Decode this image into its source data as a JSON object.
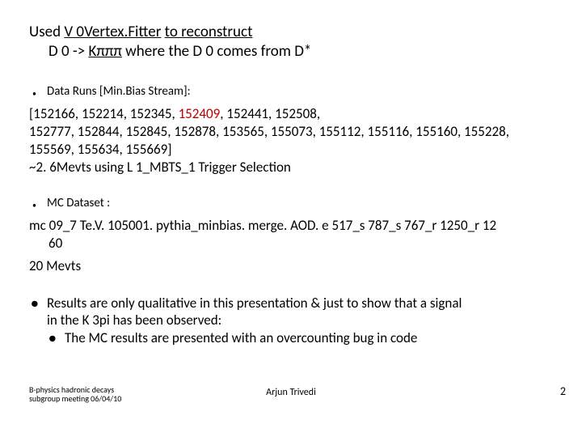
{
  "title": {
    "prefix": "Used  ",
    "underlined1": "V 0Vertex.Fitter",
    "mid1": " ",
    "underlined2": "to reconstruct",
    "line2_a": "D 0 -> ",
    "line2_underlined": "Kπππ",
    "line2_b": " where the D 0 comes from D*"
  },
  "dataRunsLabel": "Data Runs [Min.Bias Stream]:",
  "dataRuns": {
    "line1_a": "[152166, 152214, 152345, ",
    "line1_red": "152409",
    "line1_b": ", 152441, 152508,",
    "line2": "152777, 152844, 152845, 152878, 153565, 155073, 155112, 155116, 155160, 155228, 155569, 155634, 155669]",
    "line3": "~2. 6Mevts using L 1_MBTS_1 Trigger Selection"
  },
  "mcLabel": "MC Dataset :",
  "mc": {
    "line1": "mc 09_7 Te.V. 105001. pythia_minbias. merge. AOD. e 517_s 787_s 767_r 1250_r 12",
    "line1b": "60",
    "line2": "20 Mevts"
  },
  "results": {
    "b1a": "Results are only qualitative in this presentation & just to show that a signal",
    "b1b": "in the K 3pi has been observed:",
    "b2": "The MC results are presented with an overcounting bug in code"
  },
  "footer": {
    "left1": "B-physics hadronic decays",
    "left2": "subgroup meeting 06/04/10",
    "center": "Arjun Trivedi",
    "page": "2"
  }
}
